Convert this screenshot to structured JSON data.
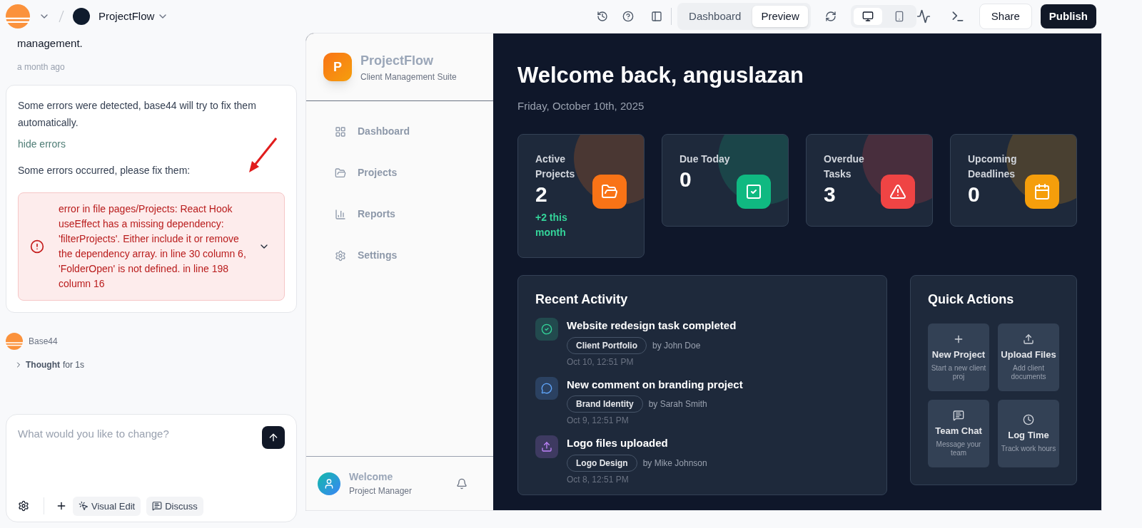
{
  "topbar": {
    "project_name": "ProjectFlow",
    "view_tabs": [
      {
        "label": "Dashboard",
        "selected": false
      },
      {
        "label": "Preview",
        "selected": true
      }
    ],
    "devices": [
      {
        "kind": "desktop",
        "selected": true
      },
      {
        "kind": "mobile",
        "selected": false
      }
    ],
    "share": "Share",
    "publish": "Publish"
  },
  "chat": {
    "prev_message": "management.",
    "prev_time": "a month ago",
    "error_card": {
      "intro": "Some errors were detected, base44 will try to fix them automatically.",
      "toggle": "hide errors",
      "prompt": "Some errors occurred, please fix them:",
      "error": "error in file pages/Projects: React Hook useEffect has a missing dependency: 'filterProjects'. Either include it or remove the dependency array. in line 30 column 6, 'FolderOpen' is not defined. in line 198 column 16"
    },
    "agent_name": "Base44",
    "thought_label": "Thought",
    "thought_time": "for 1s",
    "input": {
      "placeholder": "What would you like to change?"
    },
    "tools": [
      "Visual Edit",
      "Discuss"
    ]
  },
  "app_sidebar": {
    "logo_letter": "P",
    "title": "ProjectFlow",
    "subtitle": "Client Management Suite",
    "items": [
      {
        "label": "Dashboard",
        "kind": "grid"
      },
      {
        "label": "Projects",
        "kind": "folder"
      },
      {
        "label": "Reports",
        "kind": "chart"
      },
      {
        "label": "Settings",
        "kind": "gear"
      }
    ],
    "user_greeting": "Welcome",
    "user_role": "Project Manager"
  },
  "dashboard": {
    "title": "Welcome back, anguslazan",
    "date": "Friday, October 10th, 2025",
    "stats": [
      {
        "label": "Active Projects",
        "value": "2",
        "note": "+2 this month",
        "kind": "folder",
        "color": "#f97316"
      },
      {
        "label": "Due Today",
        "value": "0",
        "kind": "check",
        "color": "#10b981"
      },
      {
        "label": "Overdue Tasks",
        "value": "3",
        "kind": "alert",
        "color": "#ef4444"
      },
      {
        "label": "Upcoming Deadlines",
        "value": "0",
        "kind": "calendar",
        "color": "#f59e0b"
      }
    ],
    "activity": {
      "title": "Recent Activity",
      "items": [
        {
          "title": "Website redesign task completed",
          "tag": "Client Portfolio",
          "by": "by John Doe",
          "time": "Oct 10, 12:51 PM",
          "kind": "check",
          "color": "#34d399"
        },
        {
          "title": "New comment on branding project",
          "tag": "Brand Identity",
          "by": "by Sarah Smith",
          "time": "Oct 9, 12:51 PM",
          "kind": "chat",
          "color": "#60a5fa"
        },
        {
          "title": "Logo files uploaded",
          "tag": "Logo Design",
          "by": "by Mike Johnson",
          "time": "Oct 8, 12:51 PM",
          "kind": "upload",
          "color": "#c084fc"
        }
      ]
    },
    "quick_actions": {
      "title": "Quick Actions",
      "items": [
        {
          "label": "New Project",
          "hint": "Start a new client proj",
          "kind": "plus"
        },
        {
          "label": "Upload Files",
          "hint": "Add client documents",
          "kind": "upload"
        },
        {
          "label": "Team Chat",
          "hint": "Message your team",
          "kind": "chat"
        },
        {
          "label": "Log Time",
          "hint": "Track work hours",
          "kind": "clock"
        }
      ]
    }
  }
}
